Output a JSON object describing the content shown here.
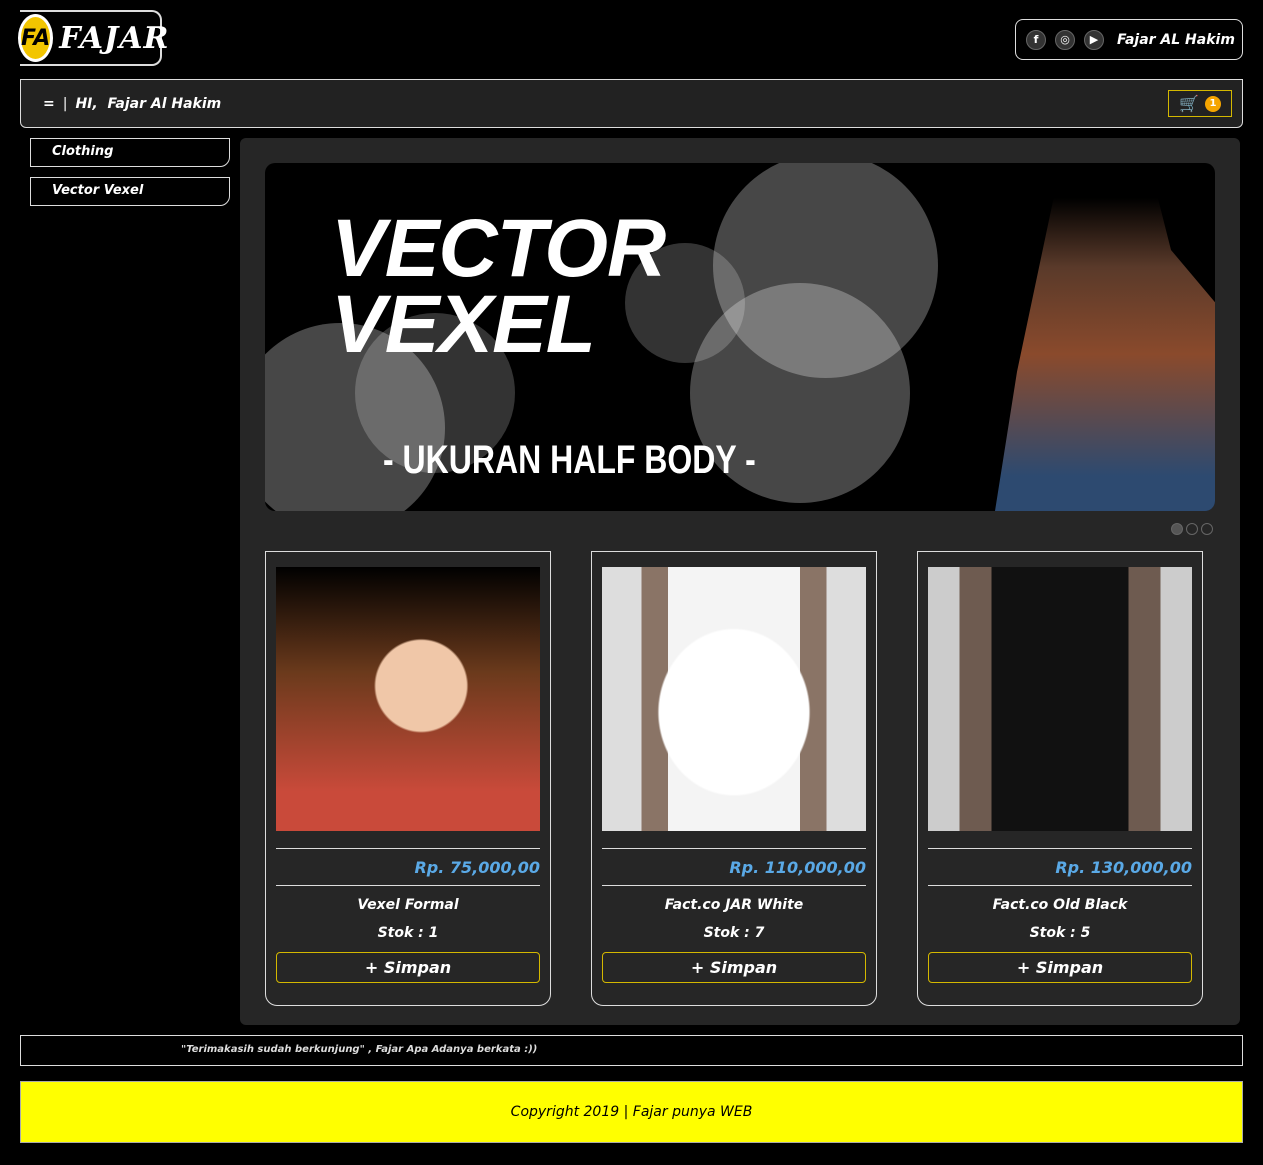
{
  "header": {
    "logo_text": "FAJAR",
    "logo_mark": "FA",
    "owner_name": "Fajar AL Hakim",
    "social": [
      "facebook-icon",
      "instagram-icon",
      "youtube-icon"
    ]
  },
  "nav": {
    "menu_icon": "=",
    "separator": "|",
    "greeting": "HI,  Fajar Al Hakim",
    "cart_count": "1"
  },
  "sidebar": {
    "items": [
      {
        "label": "Clothing"
      },
      {
        "label": "Vector Vexel"
      }
    ]
  },
  "banner": {
    "title_line1": "VECTOR",
    "title_line2": "VEXEL",
    "subtitle": "- UKURAN HALF BODY -",
    "slides": 3,
    "active_slide": 0
  },
  "products": [
    {
      "price": "Rp. 75,000,00",
      "name": "Vexel Formal",
      "stock": "Stok : 1",
      "button": "+ Simpan"
    },
    {
      "price": "Rp. 110,000,00",
      "name": "Fact.co JAR White",
      "stock": "Stok : 7",
      "button": "+ Simpan"
    },
    {
      "price": "Rp. 130,000,00",
      "name": "Fact.co Old Black",
      "stock": "Stok : 5",
      "button": "+ Simpan"
    }
  ],
  "footer": {
    "quote": "\"Terimakasih sudah berkunjung\" , Fajar Apa Adanya berkata :))",
    "copyright": "Copyright 2019 | Fajar punya WEB"
  },
  "colors": {
    "accent": "#d4b800",
    "price": "#5aa9e6",
    "footer_bg": "#ffff00"
  }
}
